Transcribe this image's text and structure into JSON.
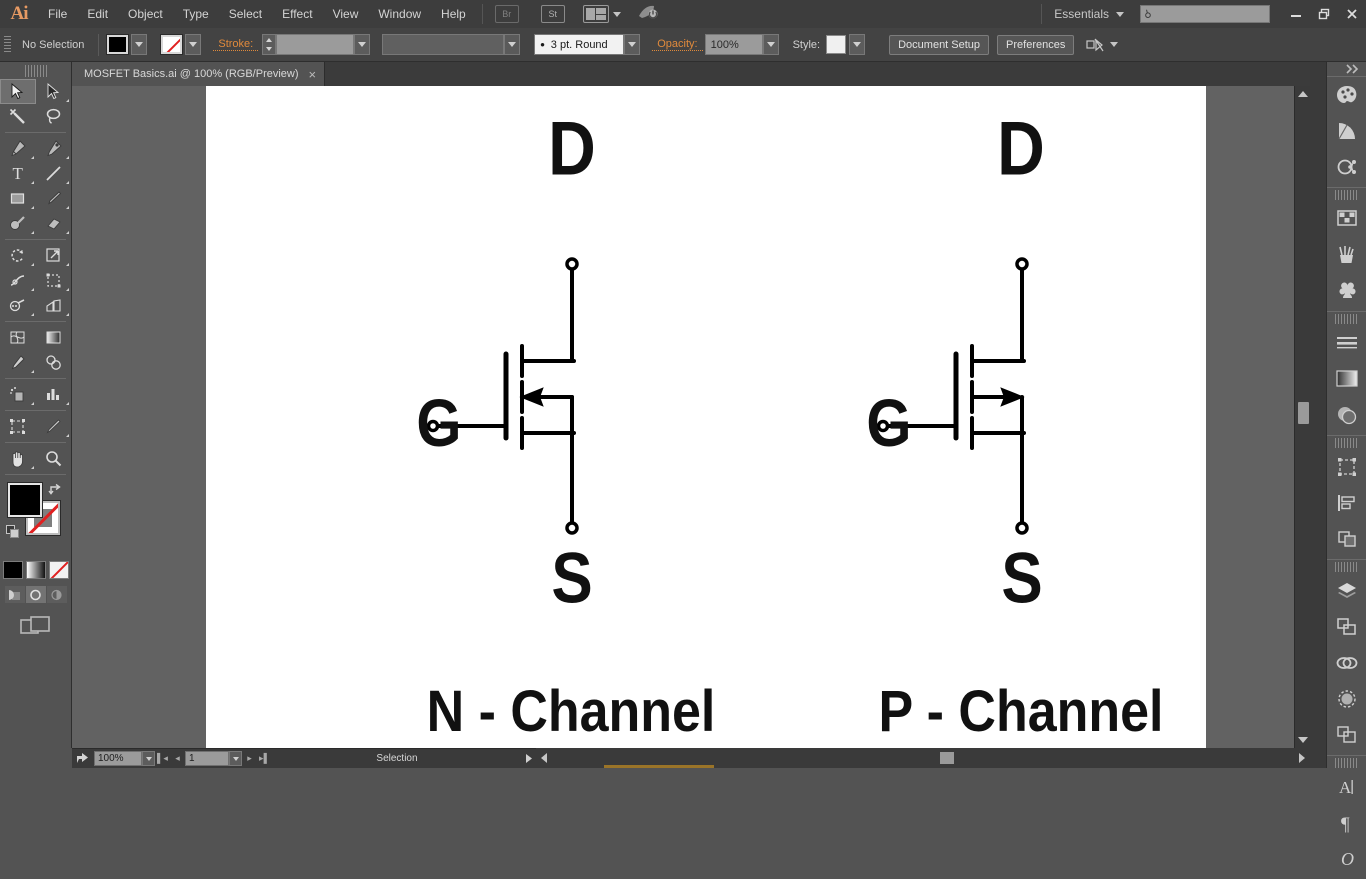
{
  "app": {
    "name": "Ai",
    "logo_color": "#e79a63"
  },
  "menubar": {
    "items": [
      "File",
      "Edit",
      "Object",
      "Type",
      "Select",
      "Effect",
      "View",
      "Window",
      "Help"
    ],
    "bridge_label": "Br",
    "stock_label": "St",
    "workspace": "Essentials",
    "search_placeholder": "",
    "minimize": "—",
    "restore": "❐",
    "close": "✕"
  },
  "controlbar": {
    "selection_state": "No Selection",
    "fill_color": "#000000",
    "stroke_color": "none",
    "stroke_label": "Stroke:",
    "stroke_weight": "",
    "stroke_profile": "",
    "brush_definition": "3 pt. Round",
    "opacity_label": "Opacity:",
    "opacity_value": "100%",
    "style_label": "Style:",
    "document_setup_label": "Document Setup",
    "preferences_label": "Preferences"
  },
  "document_tab": {
    "title": "MOSFET Basics.ai @ 100% (RGB/Preview)",
    "close": "×"
  },
  "toolbar": {
    "tools": [
      {
        "name": "selection-tool",
        "glyph": "➤",
        "selected": true,
        "sub": false
      },
      {
        "name": "direct-selection-tool",
        "glyph": "➤",
        "selected": false,
        "sub": true
      },
      {
        "name": "magic-wand-tool",
        "glyph": "✳",
        "selected": false,
        "sub": false
      },
      {
        "name": "lasso-tool",
        "glyph": "❀",
        "selected": false,
        "sub": false
      },
      {
        "name": "pen-tool",
        "glyph": "✒",
        "selected": false,
        "sub": true
      },
      {
        "name": "curvature-tool",
        "glyph": "✒",
        "selected": false,
        "sub": true
      },
      {
        "name": "type-tool",
        "glyph": "T",
        "selected": false,
        "sub": true
      },
      {
        "name": "line-segment-tool",
        "glyph": "╱",
        "selected": false,
        "sub": true
      },
      {
        "name": "rectangle-tool",
        "glyph": "▢",
        "selected": false,
        "sub": true
      },
      {
        "name": "paintbrush-tool",
        "glyph": "✐",
        "selected": false,
        "sub": true
      },
      {
        "name": "shaper-tool",
        "glyph": "●",
        "selected": false,
        "sub": true
      },
      {
        "name": "eraser-tool",
        "glyph": "▱",
        "selected": false,
        "sub": true
      },
      {
        "name": "rotate-tool",
        "glyph": "↻",
        "selected": false,
        "sub": true
      },
      {
        "name": "scale-tool",
        "glyph": "⤡",
        "selected": false,
        "sub": true
      },
      {
        "name": "width-tool",
        "glyph": "✂",
        "selected": false,
        "sub": true
      },
      {
        "name": "free-transform-tool",
        "glyph": "⬚",
        "selected": false,
        "sub": true
      },
      {
        "name": "shape-builder-tool",
        "glyph": "◔",
        "selected": false,
        "sub": true
      },
      {
        "name": "perspective-grid-tool",
        "glyph": "◧",
        "selected": false,
        "sub": true
      },
      {
        "name": "mesh-tool",
        "glyph": "▓",
        "selected": false,
        "sub": false
      },
      {
        "name": "gradient-tool",
        "glyph": "■",
        "selected": false,
        "sub": false
      },
      {
        "name": "eyedropper-tool",
        "glyph": "⚗",
        "selected": false,
        "sub": true
      },
      {
        "name": "blend-tool",
        "glyph": "◎",
        "selected": false,
        "sub": false
      },
      {
        "name": "symbol-sprayer-tool",
        "glyph": "⚘",
        "selected": false,
        "sub": true
      },
      {
        "name": "column-graph-tool",
        "glyph": "☰",
        "selected": false,
        "sub": true
      },
      {
        "name": "artboard-tool",
        "glyph": "⬚",
        "selected": false,
        "sub": false
      },
      {
        "name": "slice-tool",
        "glyph": "╱",
        "selected": false,
        "sub": true
      },
      {
        "name": "hand-tool",
        "glyph": "✋",
        "selected": false,
        "sub": true
      },
      {
        "name": "zoom-tool",
        "glyph": "⚲",
        "selected": false,
        "sub": false
      }
    ],
    "fill_color": "#000000",
    "stroke_color": "none",
    "swap_glyph": "⇄",
    "color_modes": [
      "color",
      "gradient",
      "none"
    ],
    "draw_modes": [
      "draw-normal",
      "draw-behind",
      "draw-inside"
    ],
    "active_draw_mode": 1,
    "screen_mode": "change-screen-mode"
  },
  "canvas": {
    "artboard_bg": "#ffffff",
    "symbols": [
      {
        "id": "n-channel",
        "caption": "N - Channel",
        "drain_label": "D",
        "gate_label": "G",
        "source_label": "S",
        "arrow_direction": "left",
        "type": "N-Channel MOSFET"
      },
      {
        "id": "p-channel",
        "caption": "P - Channel",
        "drain_label": "D",
        "gate_label": "G",
        "source_label": "S",
        "arrow_direction": "right",
        "type": "P-Channel MOSFET"
      }
    ]
  },
  "statusbar": {
    "zoom_level": "100%",
    "page_number": "1",
    "status_text": "Selection"
  },
  "rightdock": {
    "groups": [
      {
        "icons": [
          {
            "name": "color-panel-icon",
            "glyph": "🎨"
          },
          {
            "name": "color-guide-panel-icon",
            "glyph": "◴"
          },
          {
            "name": "color-themes-panel-icon",
            "glyph": "⛓"
          }
        ]
      },
      {
        "icons": [
          {
            "name": "swatches-panel-icon",
            "glyph": "⊞"
          },
          {
            "name": "brushes-panel-icon",
            "glyph": "✐"
          },
          {
            "name": "symbols-panel-icon",
            "glyph": "♣"
          }
        ]
      },
      {
        "icons": [
          {
            "name": "stroke-panel-icon",
            "glyph": "≡"
          },
          {
            "name": "gradient-panel-icon",
            "glyph": "▤"
          },
          {
            "name": "transparency-panel-icon",
            "glyph": "◑"
          }
        ]
      },
      {
        "icons": [
          {
            "name": "transform-panel-icon",
            "glyph": "⬚"
          },
          {
            "name": "align-panel-icon",
            "glyph": "◧"
          },
          {
            "name": "pathfinder-panel-icon",
            "glyph": "◫"
          }
        ]
      },
      {
        "icons": [
          {
            "name": "layers-panel-icon",
            "glyph": "⬕"
          },
          {
            "name": "artboards-panel-icon",
            "glyph": "⧉"
          },
          {
            "name": "links-panel-icon",
            "glyph": "⛓"
          },
          {
            "name": "appearance-panel-icon",
            "glyph": "◌"
          },
          {
            "name": "graphic-styles-panel-icon",
            "glyph": "⧉"
          }
        ]
      },
      {
        "icons": [
          {
            "name": "character-panel-icon",
            "glyph": "A"
          },
          {
            "name": "paragraph-panel-icon",
            "glyph": "¶"
          },
          {
            "name": "opentype-panel-icon",
            "glyph": "O"
          }
        ]
      }
    ]
  }
}
